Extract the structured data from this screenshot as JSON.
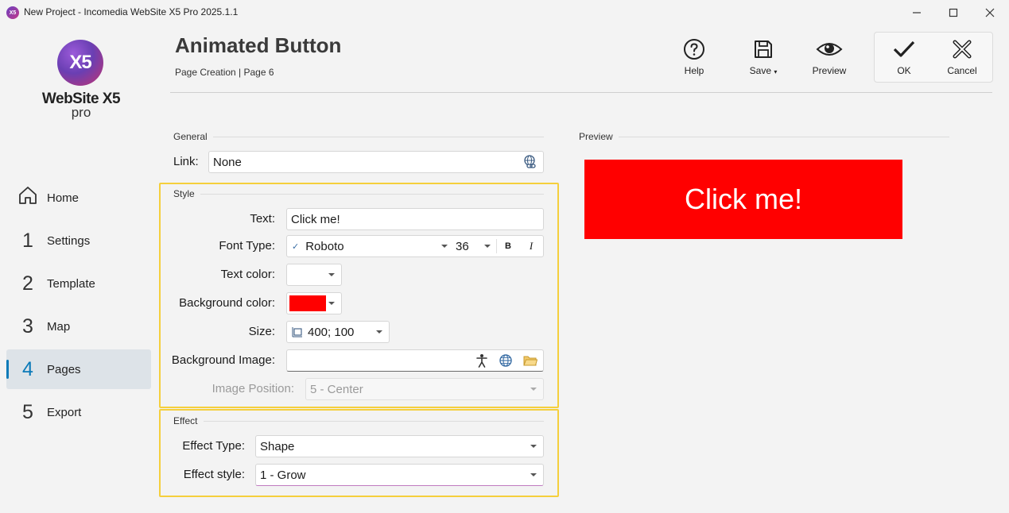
{
  "window": {
    "title": "New Project - Incomedia WebSite X5 Pro 2025.1.1",
    "app_icon": "X5",
    "controls": [
      "minimize-icon",
      "maximize-icon",
      "close-icon"
    ]
  },
  "logo": {
    "mark": "X5",
    "name": "WebSite X5",
    "edition": "pro"
  },
  "sidebar": {
    "items": [
      {
        "num": "",
        "icon": "home-icon",
        "label": "Home"
      },
      {
        "num": "1",
        "label": "Settings"
      },
      {
        "num": "2",
        "label": "Template"
      },
      {
        "num": "3",
        "label": "Map"
      },
      {
        "num": "4",
        "label": "Pages",
        "active": true
      },
      {
        "num": "5",
        "label": "Export"
      }
    ]
  },
  "header": {
    "title": "Animated Button",
    "breadcrumb": "Page Creation | Page 6"
  },
  "toolbar": {
    "help_label": "Help",
    "save_label": "Save",
    "preview_label": "Preview",
    "ok_label": "OK",
    "cancel_label": "Cancel"
  },
  "general": {
    "section": "General",
    "link_label": "Link:",
    "link_value": "None"
  },
  "style": {
    "section": "Style",
    "text_label": "Text:",
    "text_value": "Click me!",
    "font_label": "Font Type:",
    "font_value": "Roboto",
    "font_size": "36",
    "bold": "B",
    "italic": "I",
    "text_color_label": "Text color:",
    "text_color": "#ffffff",
    "bg_color_label": "Background color:",
    "bg_color": "#ff0000",
    "size_label": "Size:",
    "size_value": "400; 100",
    "bg_image_label": "Background Image:",
    "bg_image_value": "",
    "image_position_label": "Image Position:",
    "image_position_value": "5 - Center"
  },
  "effect": {
    "section": "Effect",
    "type_label": "Effect Type:",
    "type_value": "Shape",
    "style_label": "Effect style:",
    "style_value": "1 - Grow"
  },
  "preview": {
    "section": "Preview",
    "button_text": "Click me!",
    "bg_color": "#ff0000",
    "text_color": "#ffffff"
  },
  "colors": {
    "accent": "#0b7ab8",
    "highlight": "#f5cf3c"
  }
}
